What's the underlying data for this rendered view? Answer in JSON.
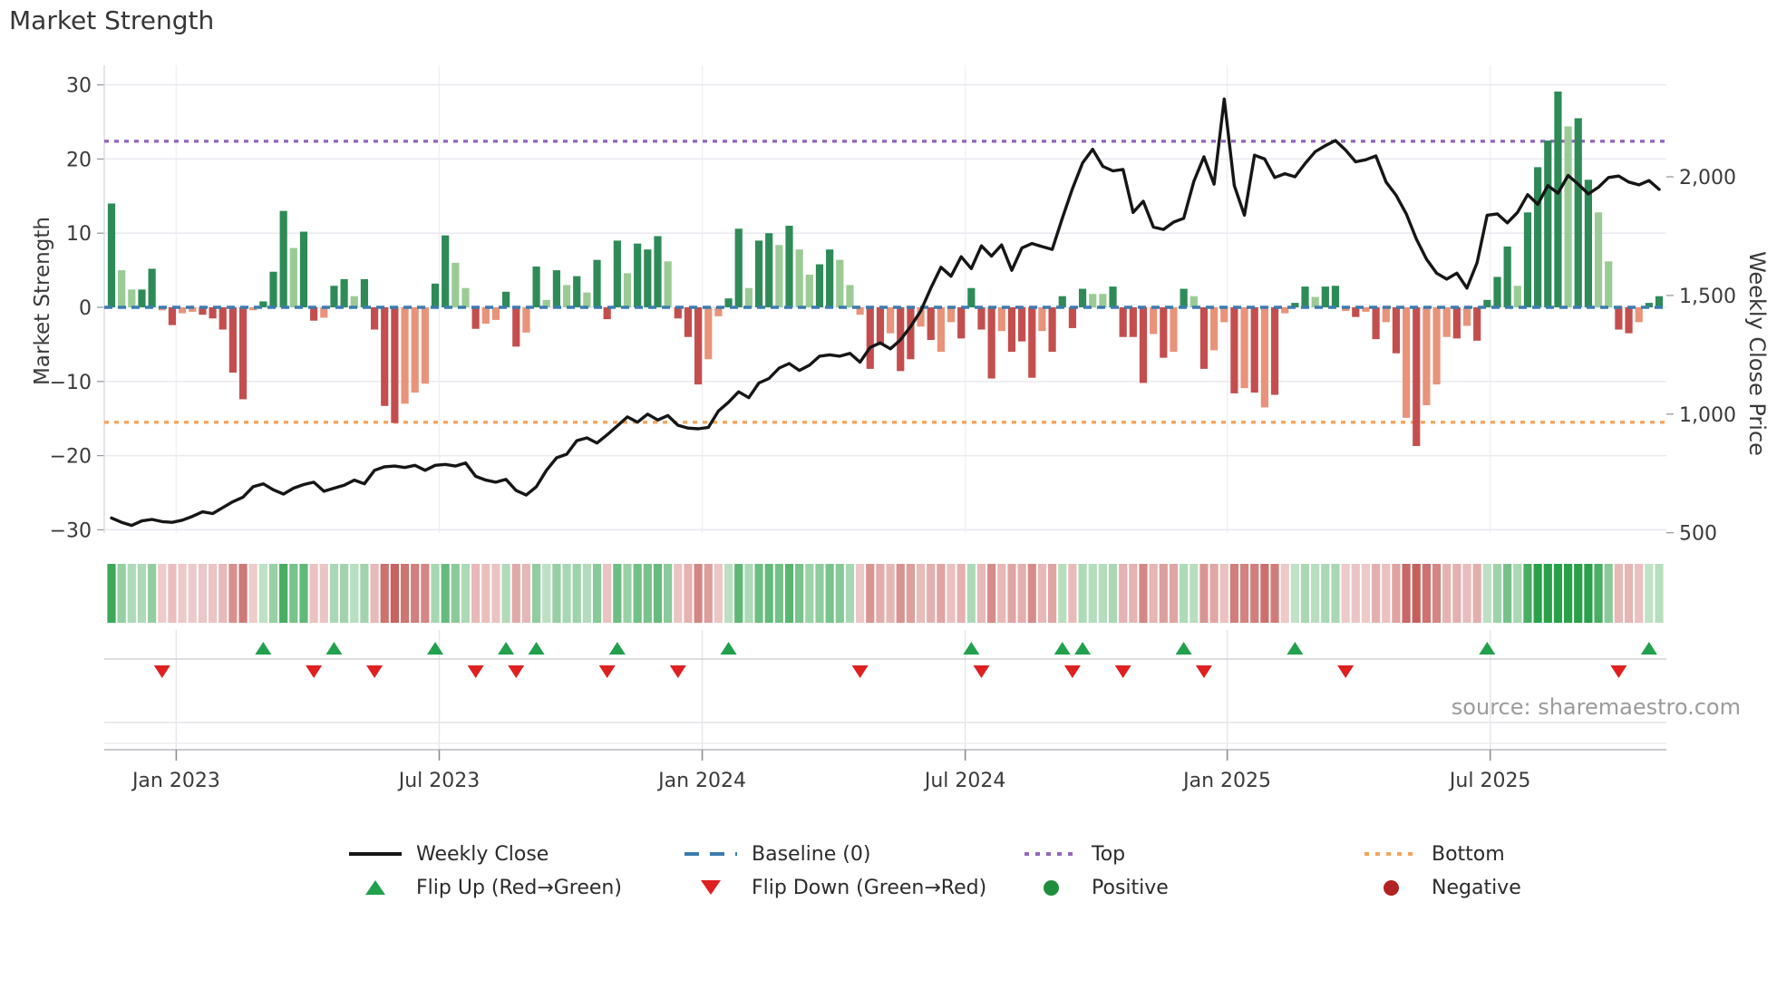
{
  "header": {
    "title": "Market Strength"
  },
  "source": {
    "credit": "source: sharemaestro.com"
  },
  "axes": {
    "left": {
      "title": "Market Strength",
      "ticks": [
        "30",
        "20",
        "10",
        "0",
        "−10",
        "−20",
        "−30"
      ],
      "tick_values": [
        30,
        20,
        10,
        0,
        -10,
        -20,
        -30
      ]
    },
    "right": {
      "title": "Weekly Close Price",
      "ticks": [
        "2,000",
        "1,500",
        "1,000",
        "500"
      ],
      "tick_values": [
        2000,
        1500,
        1000,
        500
      ]
    },
    "x": {
      "ticks": [
        "Jan 2023",
        "Jul 2023",
        "Jan 2024",
        "Jul 2024",
        "Jan 2025",
        "Jul 2025"
      ],
      "tick_weeks": [
        6.4,
        32.4,
        58.4,
        84.4,
        110.3,
        136.3
      ]
    }
  },
  "legend": {
    "weekly_close": "Weekly Close",
    "baseline": "Baseline (0)",
    "top": "Top",
    "bottom": "Bottom",
    "flip_up": "Flip Up (Red→Green)",
    "flip_down": "Flip Down (Green→Red)",
    "positive": "Positive",
    "negative": "Negative"
  },
  "colors": {
    "bar_dark_green": "#2e8b57",
    "bar_light_green": "#9bcb95",
    "bar_dark_red": "#c44e4e",
    "bar_light_red": "#e8937a",
    "baseline_blue": "#3b7cb0",
    "top_purple": "#9467bd",
    "bottom_orange": "#f5a45d",
    "price_line": "#161616",
    "flip_up_green": "#21a14d",
    "flip_down_red": "#df2020",
    "positive_green": "#1e8e3e",
    "negative_red": "#b22222",
    "heat_green_strong": "#28a148",
    "heat_red_strong": "#c65f5c",
    "grid": "#e9e9f0",
    "spine": "#c9c9cf"
  },
  "chart_data": {
    "type": "combo: weekly strength bars + weekly close line + momentum heatmap + flip markers",
    "title": "Market Strength",
    "xlabel": "",
    "ylabel_left": "Market Strength",
    "ylabel_right": "Weekly Close Price",
    "ylim_left": [
      -30,
      30
    ],
    "ylim_right": [
      500,
      2000
    ],
    "grid": "horizontal on, faint vertical at month ticks",
    "legend_position": "bottom center, two rows",
    "weeks": 154,
    "top_threshold": 22.4,
    "bottom_threshold": -15.5,
    "baseline": 0,
    "strength_bars": {
      "values": [
        14,
        5,
        2.4,
        2.4,
        5.2,
        -0.4,
        -2.4,
        -0.8,
        -0.6,
        -1,
        -1.5,
        -3,
        -8.8,
        -12.4,
        -0.4,
        0.8,
        4.8,
        13,
        8,
        10.2,
        -1.8,
        -1.4,
        2.9,
        3.8,
        1.5,
        3.8,
        -3,
        -13.3,
        -15.6,
        -13,
        -11.5,
        -10.3,
        3.2,
        9.7,
        6,
        2.6,
        -2.9,
        -2.2,
        -1.7,
        2.1,
        -5.3,
        -3.4,
        5.5,
        1,
        5,
        3,
        4.2,
        2,
        6.4,
        -1.6,
        9,
        4.6,
        8.6,
        7.8,
        9.6,
        6.2,
        -1.5,
        -4,
        -10.4,
        -7,
        -1.2,
        1.2,
        10.6,
        2.6,
        9,
        10,
        8.4,
        11,
        7.8,
        4.4,
        5.8,
        7.8,
        6.4,
        3,
        -1,
        -8.3,
        -5,
        -3.5,
        -8.6,
        -7,
        -2.6,
        -4.4,
        -6,
        -2,
        -4.2,
        2.6,
        -3,
        -9.6,
        -3.2,
        -6,
        -4.6,
        -9.5,
        -3.2,
        -6,
        1.5,
        -2.8,
        2.5,
        1.8,
        1.8,
        2.8,
        -4,
        -4,
        -10.2,
        -3.6,
        -6.8,
        -6,
        2.5,
        1.5,
        -8.3,
        -5.8,
        -2,
        -11.6,
        -10.9,
        -11.5,
        -13.5,
        -11.8,
        -0.8,
        0.6,
        2.8,
        1.4,
        2.8,
        2.9,
        -0.5,
        -1.3,
        -0.6,
        -4.3,
        -2,
        -6.2,
        -14.9,
        -18.7,
        -13.2,
        -10.4,
        -4,
        -4.2,
        -2.5,
        -4.5,
        1,
        4.1,
        8.2,
        2.9,
        12.8,
        18.9,
        22.5,
        29.1,
        24.4,
        25.5,
        17.2,
        12.8,
        6.2,
        -3,
        -3.5,
        -2,
        0.6,
        1.5
      ],
      "shades": [
        "dg",
        "lg",
        "lg",
        "dg",
        "dg",
        "lr",
        "dr",
        "lr",
        "lr",
        "dr",
        "dr",
        "dr",
        "dr",
        "dr",
        "lr",
        "dg",
        "dg",
        "dg",
        "lg",
        "dg",
        "dr",
        "lr",
        "dg",
        "dg",
        "lg",
        "dg",
        "dr",
        "dr",
        "dr",
        "lr",
        "lr",
        "lr",
        "dg",
        "dg",
        "lg",
        "lg",
        "dr",
        "lr",
        "lr",
        "dg",
        "dr",
        "lr",
        "dg",
        "lg",
        "dg",
        "lg",
        "dg",
        "lg",
        "dg",
        "dr",
        "dg",
        "lg",
        "dg",
        "dg",
        "dg",
        "lg",
        "dr",
        "dr",
        "dr",
        "lr",
        "lr",
        "dg",
        "dg",
        "lg",
        "dg",
        "dg",
        "lg",
        "dg",
        "lg",
        "lg",
        "dg",
        "dg",
        "lg",
        "lg",
        "lr",
        "dr",
        "dr",
        "lr",
        "dr",
        "dr",
        "lr",
        "dr",
        "lr",
        "lr",
        "dr",
        "dg",
        "dr",
        "dr",
        "lr",
        "dr",
        "dr",
        "dr",
        "lr",
        "dr",
        "dg",
        "dr",
        "dg",
        "lg",
        "lg",
        "dg",
        "dr",
        "dr",
        "dr",
        "lr",
        "dr",
        "lr",
        "dg",
        "lg",
        "dr",
        "lr",
        "lr",
        "dr",
        "lr",
        "dr",
        "lr",
        "dr",
        "lr",
        "dg",
        "dg",
        "lg",
        "dg",
        "dg",
        "lr",
        "dr",
        "lr",
        "dr",
        "lr",
        "dr",
        "lr",
        "dr",
        "lr",
        "lr",
        "lr",
        "dr",
        "lr",
        "dr",
        "dg",
        "dg",
        "dg",
        "lg",
        "dg",
        "dg",
        "dg",
        "dg",
        "lg",
        "dg",
        "dg",
        "lg",
        "lg",
        "dr",
        "dr",
        "lr",
        "dg",
        "dg"
      ]
    },
    "weekly_close": {
      "values": [
        562,
        544,
        531,
        550,
        556,
        547,
        544,
        553,
        569,
        588,
        581,
        606,
        631,
        650,
        694,
        706,
        681,
        663,
        688,
        703,
        713,
        675,
        688,
        700,
        722,
        706,
        763,
        778,
        781,
        775,
        784,
        763,
        784,
        788,
        781,
        794,
        738,
        722,
        713,
        725,
        678,
        659,
        694,
        763,
        816,
        831,
        888,
        900,
        878,
        913,
        950,
        988,
        966,
        1000,
        975,
        994,
        953,
        941,
        938,
        944,
        1013,
        1050,
        1094,
        1069,
        1131,
        1150,
        1194,
        1213,
        1184,
        1206,
        1244,
        1250,
        1244,
        1256,
        1219,
        1281,
        1300,
        1275,
        1313,
        1369,
        1434,
        1531,
        1619,
        1581,
        1663,
        1613,
        1709,
        1666,
        1713,
        1606,
        1700,
        1719,
        1706,
        1694,
        1825,
        1950,
        2059,
        2116,
        2044,
        2025,
        2031,
        1850,
        1897,
        1788,
        1778,
        1809,
        1825,
        1981,
        2084,
        1969,
        2328,
        1963,
        1838,
        2091,
        2075,
        1997,
        2013,
        2000,
        2056,
        2106,
        2131,
        2153,
        2113,
        2063,
        2072,
        2088,
        1978,
        1922,
        1844,
        1738,
        1653,
        1594,
        1569,
        1594,
        1531,
        1638,
        1838,
        1844,
        1806,
        1850,
        1925,
        1884,
        1963,
        1931,
        2006,
        1969,
        1928,
        1956,
        1997,
        2003,
        1978,
        1966,
        1984,
        1947
      ]
    }
  }
}
